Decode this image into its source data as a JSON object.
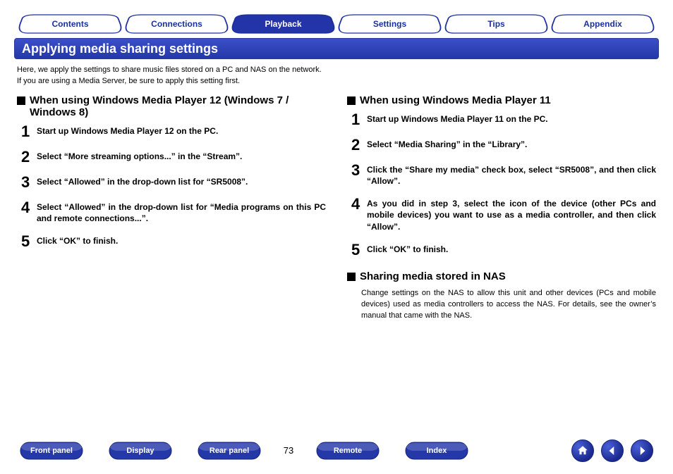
{
  "nav": {
    "tabs": [
      {
        "label": "Contents",
        "active": false
      },
      {
        "label": "Connections",
        "active": false
      },
      {
        "label": "Playback",
        "active": true
      },
      {
        "label": "Settings",
        "active": false
      },
      {
        "label": "Tips",
        "active": false
      },
      {
        "label": "Appendix",
        "active": false
      }
    ]
  },
  "section_title": "Applying media sharing settings",
  "intro_line1": "Here, we apply the settings to share music files stored on a PC and NAS on the network.",
  "intro_line2": "If you are using a Media Server, be sure to apply this setting first.",
  "left": {
    "heading": "When using Windows Media Player 12 (Windows 7 / Windows 8)",
    "steps": [
      "Start up Windows Media Player 12 on the PC.",
      "Select “More streaming options...” in the “Stream”.",
      "Select “Allowed” in the drop-down list for “SR5008”.",
      "Select “Allowed” in the drop-down list for “Media programs on this PC and remote connections...”.",
      "Click “OK” to finish."
    ]
  },
  "right": {
    "heading": "When using Windows Media Player 11",
    "steps": [
      "Start up Windows Media Player 11 on the PC.",
      "Select “Media Sharing” in the “Library”.",
      "Click the “Share my media” check box, select “SR5008”, and then click “Allow”.",
      "As you did in step 3, select the icon of the device (other PCs and mobile devices) you want to use as a media controller, and then click “Allow”.",
      "Click “OK” to finish."
    ],
    "nas_heading": "Sharing media stored in NAS",
    "nas_body": "Change settings on the NAS to allow this unit and other devices (PCs and mobile devices) used as media controllers to access the NAS. For details, see the owner’s manual that came with the NAS."
  },
  "footer": {
    "buttons_left": [
      "Front panel",
      "Display",
      "Rear panel"
    ],
    "buttons_right": [
      "Remote",
      "Index"
    ],
    "page_number": "73",
    "icons": [
      "home-icon",
      "prev-icon",
      "next-icon"
    ]
  },
  "step_numbers": [
    "1",
    "2",
    "3",
    "4",
    "5"
  ]
}
